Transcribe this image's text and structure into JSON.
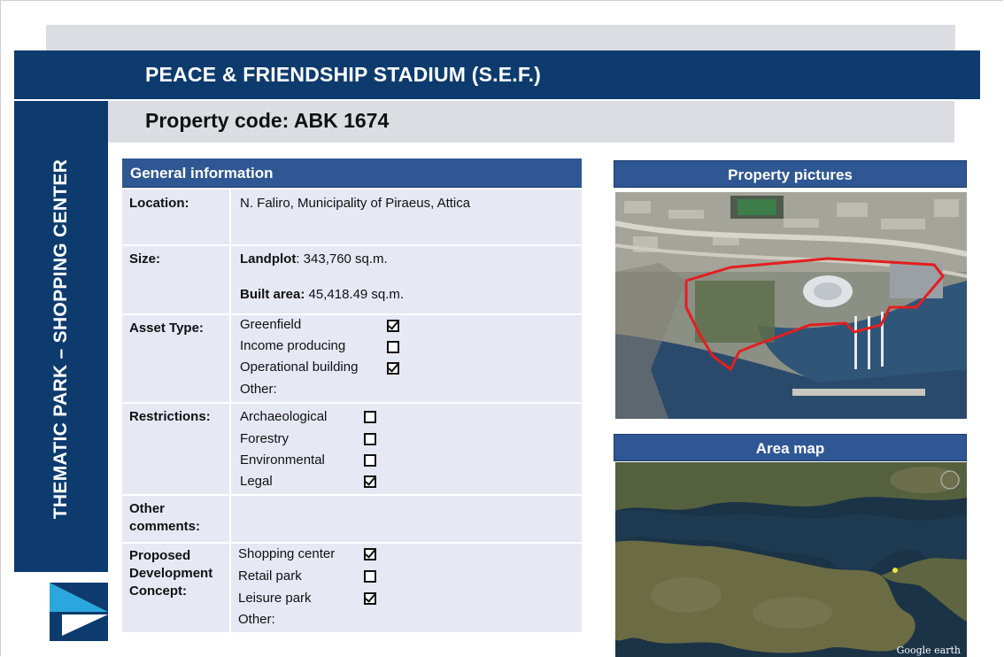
{
  "header": {
    "title": "PEACE & FRIENDSHIP STADIUM (S.E.F.)",
    "property_code": "Property code: ABK 1674"
  },
  "sidebar": {
    "vertical_label": "THEMATIC PARK – SHOPPING CENTER"
  },
  "general_info": {
    "heading": "General information",
    "location": {
      "label": "Location:",
      "value": "N. Faliro, Municipality of Piraeus, Attica"
    },
    "size": {
      "label": "Size:",
      "landplot_label": "Landplot",
      "landplot_value": ": 343,760 sq.m.",
      "built_label": "Built area:",
      "built_value": " 45,418.49 sq.m."
    },
    "asset_type": {
      "label": "Asset Type:",
      "options": [
        {
          "label": "Greenfield",
          "checked": true
        },
        {
          "label": "Income producing",
          "checked": false
        },
        {
          "label": "Operational building",
          "checked": true
        }
      ],
      "other": "Other:"
    },
    "restrictions": {
      "label": "Restrictions:",
      "options": [
        {
          "label": "Archaeological",
          "checked": false
        },
        {
          "label": "Forestry",
          "checked": false
        },
        {
          "label": "Environmental",
          "checked": false
        },
        {
          "label": "Legal",
          "checked": true
        }
      ]
    },
    "other_comments": {
      "label_line1": "Other",
      "label_line2": "comments:",
      "value": ""
    },
    "development": {
      "label_line1": "Proposed",
      "label_line2": "Development",
      "label_line3": "Concept:",
      "options": [
        {
          "label": "Shopping center",
          "checked": true
        },
        {
          "label": "Retail  park",
          "checked": false
        },
        {
          "label": "Leisure park",
          "checked": true
        }
      ],
      "other": "Other:"
    }
  },
  "right_panel": {
    "pictures_heading": "Property pictures",
    "map_heading": "Area map",
    "map_credit": "Google earth"
  },
  "colors": {
    "navy": "#0d3b6e",
    "header_blue": "#2f5793",
    "row_bg": "#e6e8f4",
    "band_gray": "#dcdde2"
  }
}
